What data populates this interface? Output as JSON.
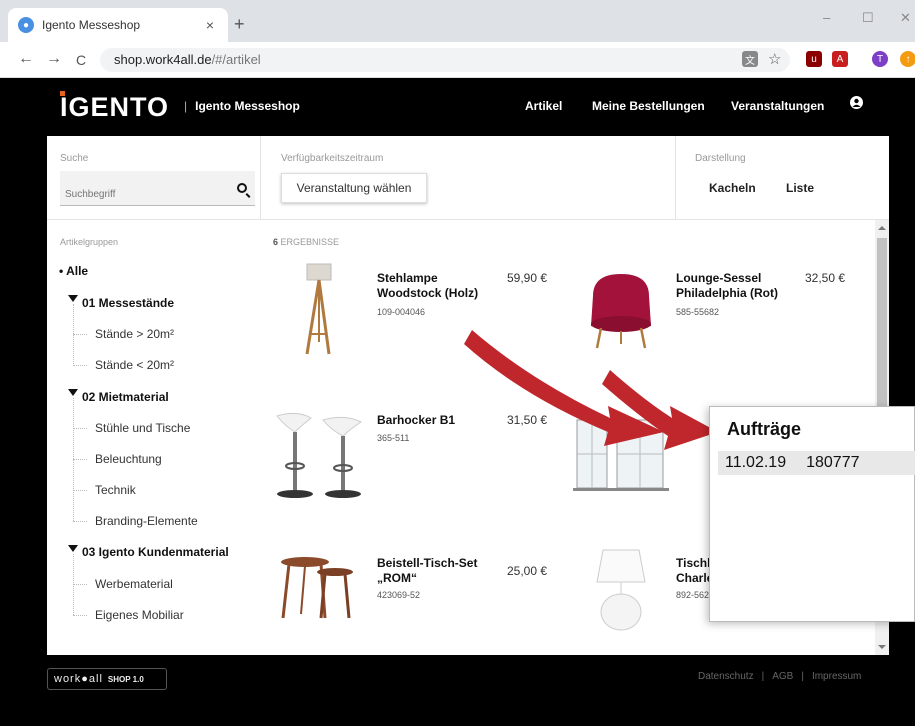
{
  "browser": {
    "tab_title": "Igento Messeshop",
    "tab_close": "×",
    "new_tab": "+",
    "url_host": "shop.work4all.de",
    "url_path": "/#/artikel",
    "back": "←",
    "forward": "→",
    "reload": "C",
    "bookmark_star": "☆",
    "window_minimize": "–",
    "window_maximize": "☐",
    "window_close": "✕",
    "profile_initial": "T"
  },
  "site": {
    "logo": "IGENTO",
    "shop_sep": "|",
    "shop_name": "Igento Messeshop",
    "nav": [
      "Artikel",
      "Meine Bestellungen",
      "Veranstaltungen"
    ]
  },
  "filters": {
    "search_label": "Suche",
    "search_placeholder": "Suchbegriff",
    "period_label": "Verfügbarkeitszeitraum",
    "event_button": "Veranstaltung wählen",
    "view_label": "Darstellung",
    "view_options": [
      "Kacheln",
      "Liste"
    ]
  },
  "groups": {
    "title": "Artikelgruppen",
    "all": "• Alle",
    "g1": "01 Messestände",
    "g1_items": [
      "Stände > 20m²",
      "Stände < 20m²"
    ],
    "g2": "02 Mietmaterial",
    "g2_items": [
      "Stühle und Tische",
      "Beleuchtung",
      "Technik",
      "Branding-Elemente"
    ],
    "g3": "03 Igento Kundenmaterial",
    "g3_items": [
      "Werbematerial",
      "Eigenes Mobiliar"
    ]
  },
  "results": {
    "count": "6",
    "label": "ERGEBNISSE"
  },
  "products": [
    {
      "name_1": "Stehlampe",
      "name_2": "Woodstock (Holz)",
      "sku": "109-004046",
      "price": "59,90 €"
    },
    {
      "name_1": "Lounge-Sessel",
      "name_2": "Philadelphia (Rot)",
      "sku": "585-55682",
      "price": "32,50 €"
    },
    {
      "name_1": "Barhocker B1",
      "name_2": "",
      "sku": "365-511",
      "price": "31,50 €"
    },
    {
      "name_1": "Beistell-Tisch-Set",
      "name_2": "„ROM“",
      "sku": "423069-52",
      "price": "25,00 €"
    },
    {
      "name_1": "Tischl",
      "name_2": "Charle",
      "sku": "892-562",
      "price": ""
    }
  ],
  "popup": {
    "title": "Aufträge",
    "date": "11.02.19",
    "number": "180777"
  },
  "footer": {
    "logo": "work",
    "logo_2": "all",
    "logo_version": "SHOP 1.0",
    "links": [
      "Datenschutz",
      "AGB",
      "Impressum"
    ],
    "sep": "|"
  },
  "colors": {
    "accent_orange": "#e8641c",
    "arrow_red": "#c0272d",
    "sessel_red": "#a3123a"
  }
}
